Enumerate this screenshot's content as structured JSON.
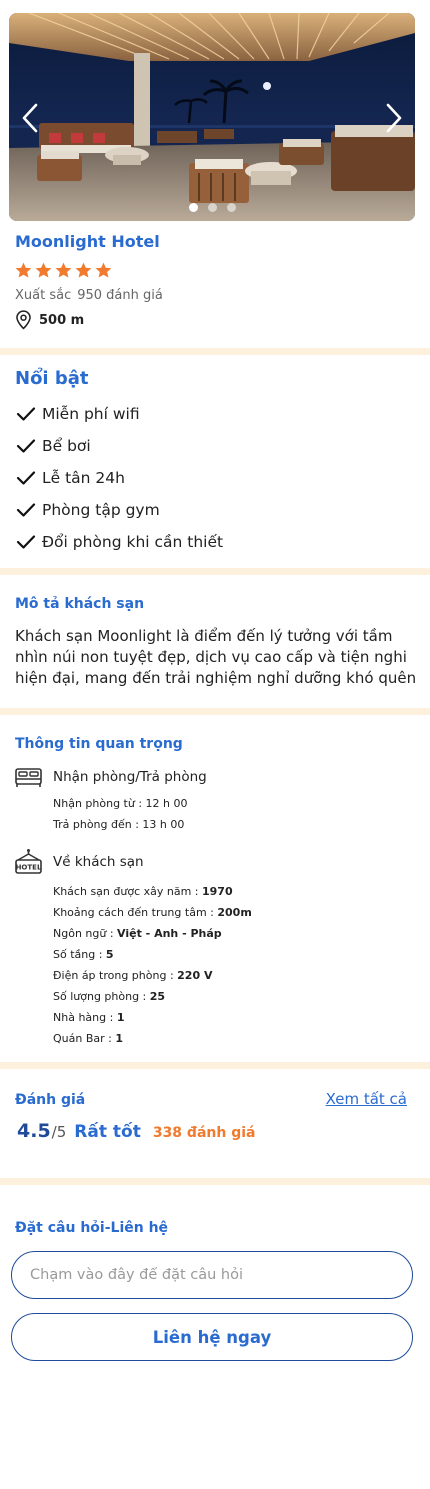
{
  "hotel": {
    "name": "Moonlight Hotel",
    "stars": 5,
    "rating_word": "Xuất sắc",
    "reviews_text": "950 đánh giá",
    "distance": "500 m",
    "carousel": {
      "slides": 3,
      "active_slide": 1
    }
  },
  "highlights": {
    "title": "Nổi bật",
    "items": [
      "Miễn phí wifi",
      "Bể bơi",
      "Lễ tân 24h",
      "Phòng tập gym",
      "Đổi phòng khi cần thiết"
    ]
  },
  "description": {
    "title": "Mô tả khách sạn",
    "text": "Khách sạn Moonlight là điểm đến lý tưởng với tầm nhìn núi non tuyệt đẹp, dịch vụ cao cấp và tiện nghi hiện đại, mang đến trải nghiệm nghỉ dưỡng khó quên"
  },
  "important_info": {
    "title": "Thông tin quan trọng",
    "checkin": {
      "heading": "Nhận phòng/Trả phòng",
      "lines": [
        {
          "label": "Nhận phòng từ : ",
          "value": "12 h 00",
          "bold": false
        },
        {
          "label": "Trả phòng đến : ",
          "value": "13 h 00",
          "bold": false
        }
      ]
    },
    "about": {
      "heading": "Về khách sạn",
      "lines": [
        {
          "label": "Khách sạn được xây năm : ",
          "value": "1970",
          "bold": true
        },
        {
          "label": "Khoảng cách đến trung tâm : ",
          "value": "200m",
          "bold": true
        },
        {
          "label": "Ngôn ngữ : ",
          "value": "Việt - Anh - Pháp",
          "bold": true
        },
        {
          "label": "Số tầng : ",
          "value": "5",
          "bold": true
        },
        {
          "label": "Điện áp trong phòng : ",
          "value": "220 V",
          "bold": true
        },
        {
          "label": "Số lượng phòng : ",
          "value": "25",
          "bold": true
        },
        {
          "label": "Nhà hàng : ",
          "value": "1",
          "bold": true
        },
        {
          "label": "Quán Bar : ",
          "value": "1",
          "bold": true
        }
      ]
    }
  },
  "reviews": {
    "title": "Đánh giá",
    "see_all": "Xem tất cả",
    "score": "4.5",
    "max": "/5",
    "word": "Rất tốt",
    "count": "338 đánh giá"
  },
  "contact": {
    "title": "Đặt câu hỏi-Liên hệ",
    "input_placeholder": "Chạm vào đây để đặt câu hỏi",
    "button_label": "Liên hệ ngay"
  },
  "colors": {
    "primary": "#2a6bd0",
    "dark_blue": "#1f4b9a",
    "star_orange": "#f07a2e",
    "divider": "#fdf0dc"
  }
}
